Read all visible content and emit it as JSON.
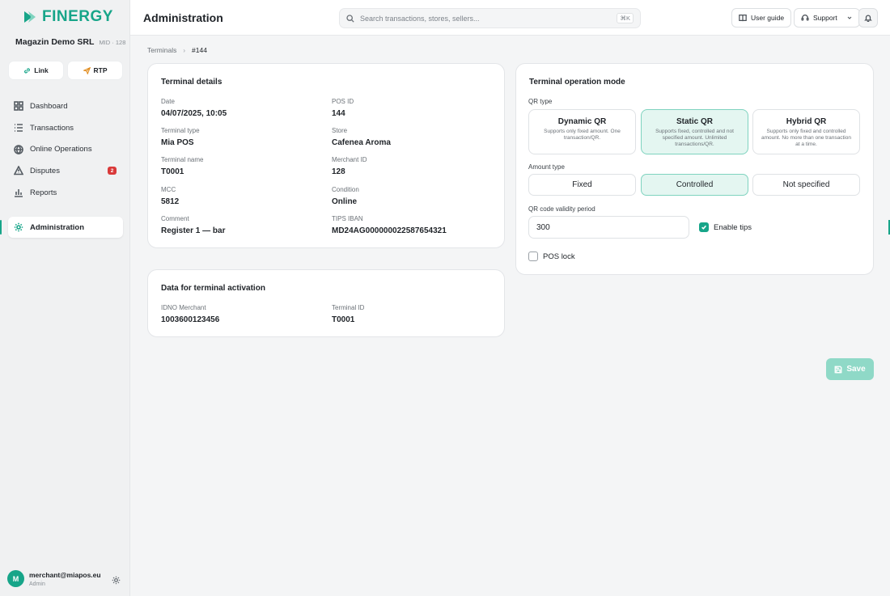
{
  "brand": {
    "name": "FINERGY",
    "color": "#17a589"
  },
  "company": {
    "name": "Magazin Demo SRL",
    "mid": "MID · 128"
  },
  "quick_actions": {
    "link_label": "Link",
    "rtp_label": "RTP"
  },
  "sidebar": {
    "items": [
      {
        "label": "Dashboard",
        "icon": "dashboard-icon"
      },
      {
        "label": "Transactions",
        "icon": "list-icon"
      },
      {
        "label": "Online Operations",
        "icon": "globe-icon"
      },
      {
        "label": "Disputes",
        "icon": "warning-icon",
        "badge": "2"
      },
      {
        "label": "Reports",
        "icon": "bar-chart-icon"
      }
    ],
    "active": {
      "label": "Administration",
      "icon": "gear-icon"
    }
  },
  "user": {
    "initial": "M",
    "email": "merchant@miapos.eu",
    "role": "Admin"
  },
  "header": {
    "title": "Administration",
    "search_placeholder": "Search transactions, stores, sellers...",
    "search_shortcut": "⌘K",
    "user_guide_label": "User guide",
    "support_label": "Support"
  },
  "breadcrumb": {
    "parent": "Terminals",
    "current": "#144"
  },
  "terminal_details": {
    "title": "Terminal details",
    "fields": [
      {
        "label": "Date",
        "value": "04/07/2025, 10:05"
      },
      {
        "label": "POS ID",
        "value": "144"
      },
      {
        "label": "Terminal type",
        "value": "Mia POS"
      },
      {
        "label": "Store",
        "value": "Cafenea Aroma"
      },
      {
        "label": "Terminal name",
        "value": "T0001"
      },
      {
        "label": "Merchant ID",
        "value": "128"
      },
      {
        "label": "MCC",
        "value": "5812"
      },
      {
        "label": "Condition",
        "value": "Online"
      },
      {
        "label": "Comment",
        "value": "Register 1 — bar"
      },
      {
        "label": "TIPS IBAN",
        "value": "MD24AG000000022587654321"
      }
    ]
  },
  "activation": {
    "title": "Data for terminal activation",
    "fields": [
      {
        "label": "IDNO Merchant",
        "value": "1003600123456"
      },
      {
        "label": "Terminal ID",
        "value": "T0001"
      }
    ]
  },
  "operation_mode": {
    "title": "Terminal operation mode",
    "qr_type_label": "QR type",
    "qr_types": [
      {
        "title": "Dynamic QR",
        "desc": "Supports only fixed amount. One transaction/QR.",
        "selected": false
      },
      {
        "title": "Static QR",
        "desc": "Supports fixed, controlled and not specified amount. Unlimited transactions/QR.",
        "selected": true
      },
      {
        "title": "Hybrid QR",
        "desc": "Supports only fixed and controlled amount. No more than one transaction at a time.",
        "selected": false
      }
    ],
    "amount_type_label": "Amount type",
    "amount_types": [
      {
        "label": "Fixed",
        "selected": false
      },
      {
        "label": "Controlled",
        "selected": true
      },
      {
        "label": "Not specified",
        "selected": false
      }
    ],
    "validity_label": "QR code validity period",
    "validity_value": "300",
    "enable_tips_label": "Enable tips",
    "enable_tips_checked": true,
    "pos_lock_label": "POS lock",
    "pos_lock_checked": false
  },
  "save_label": "Save"
}
